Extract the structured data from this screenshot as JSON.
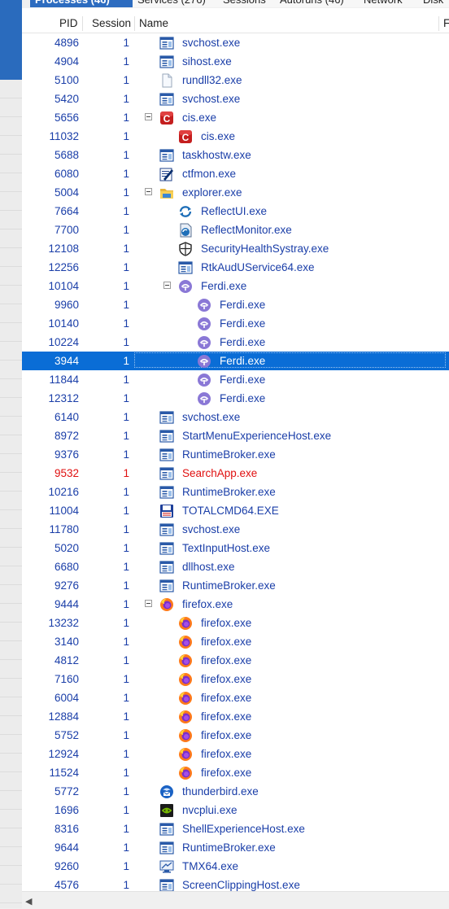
{
  "tabs": [
    {
      "label": "Processes (46)",
      "active": true
    },
    {
      "label": "Services (276)",
      "active": false
    },
    {
      "label": "Sessions",
      "active": false
    },
    {
      "label": "Autoruns (46)",
      "active": false
    },
    {
      "label": "Network",
      "active": false
    },
    {
      "label": "Disk",
      "active": false
    }
  ],
  "columns": {
    "pid": "PID",
    "session": "Session",
    "name": "Name",
    "extra": "F"
  },
  "colors": {
    "pid_text": "#1a3ea8",
    "highlight_red": "#e01010",
    "selection": "#0a6dd6",
    "tab_active": "#2d6cc0"
  },
  "processes": [
    {
      "pid": "4896",
      "session": "1",
      "name": "svchost.exe",
      "indent": 0,
      "icon": "window-app-icon"
    },
    {
      "pid": "4904",
      "session": "1",
      "name": "sihost.exe",
      "indent": 0,
      "icon": "window-app-icon"
    },
    {
      "pid": "5100",
      "session": "1",
      "name": "rundll32.exe",
      "indent": 0,
      "icon": "blank-file-icon"
    },
    {
      "pid": "5420",
      "session": "1",
      "name": "svchost.exe",
      "indent": 0,
      "icon": "window-app-icon"
    },
    {
      "pid": "5656",
      "session": "1",
      "name": "cis.exe",
      "indent": 0,
      "icon": "comodo-icon",
      "expanded": true
    },
    {
      "pid": "11032",
      "session": "1",
      "name": "cis.exe",
      "indent": 1,
      "icon": "comodo-icon"
    },
    {
      "pid": "5688",
      "session": "1",
      "name": "taskhostw.exe",
      "indent": 0,
      "icon": "window-app-icon"
    },
    {
      "pid": "6080",
      "session": "1",
      "name": "ctfmon.exe",
      "indent": 0,
      "icon": "ctfmon-pen-icon"
    },
    {
      "pid": "5004",
      "session": "1",
      "name": "explorer.exe",
      "indent": 0,
      "icon": "folder-icon",
      "expanded": true
    },
    {
      "pid": "7664",
      "session": "1",
      "name": "ReflectUI.exe",
      "indent": 1,
      "icon": "reflect-arrows-icon"
    },
    {
      "pid": "7700",
      "session": "1",
      "name": "ReflectMonitor.exe",
      "indent": 1,
      "icon": "reflect-monitor-icon"
    },
    {
      "pid": "12108",
      "session": "1",
      "name": "SecurityHealthSystray.exe",
      "indent": 1,
      "icon": "shield-icon"
    },
    {
      "pid": "12256",
      "session": "1",
      "name": "RtkAudUService64.exe",
      "indent": 1,
      "icon": "window-app-icon"
    },
    {
      "pid": "10104",
      "session": "1",
      "name": "Ferdi.exe",
      "indent": 1,
      "icon": "ferdi-icon",
      "expanded": true
    },
    {
      "pid": "9960",
      "session": "1",
      "name": "Ferdi.exe",
      "indent": 2,
      "icon": "ferdi-icon"
    },
    {
      "pid": "10140",
      "session": "1",
      "name": "Ferdi.exe",
      "indent": 2,
      "icon": "ferdi-icon"
    },
    {
      "pid": "10224",
      "session": "1",
      "name": "Ferdi.exe",
      "indent": 2,
      "icon": "ferdi-icon"
    },
    {
      "pid": "3944",
      "session": "1",
      "name": "Ferdi.exe",
      "indent": 2,
      "icon": "ferdi-icon",
      "selected": true
    },
    {
      "pid": "11844",
      "session": "1",
      "name": "Ferdi.exe",
      "indent": 2,
      "icon": "ferdi-icon"
    },
    {
      "pid": "12312",
      "session": "1",
      "name": "Ferdi.exe",
      "indent": 2,
      "icon": "ferdi-icon"
    },
    {
      "pid": "6140",
      "session": "1",
      "name": "svchost.exe",
      "indent": 0,
      "icon": "window-app-icon"
    },
    {
      "pid": "8972",
      "session": "1",
      "name": "StartMenuExperienceHost.exe",
      "indent": 0,
      "icon": "window-app-icon"
    },
    {
      "pid": "9376",
      "session": "1",
      "name": "RuntimeBroker.exe",
      "indent": 0,
      "icon": "window-app-icon"
    },
    {
      "pid": "9532",
      "session": "1",
      "name": "SearchApp.exe",
      "indent": 0,
      "icon": "window-app-icon",
      "red": true
    },
    {
      "pid": "10216",
      "session": "1",
      "name": "RuntimeBroker.exe",
      "indent": 0,
      "icon": "window-app-icon"
    },
    {
      "pid": "11004",
      "session": "1",
      "name": "TOTALCMD64.EXE",
      "indent": 0,
      "icon": "floppy-disk-icon"
    },
    {
      "pid": "11780",
      "session": "1",
      "name": "svchost.exe",
      "indent": 0,
      "icon": "window-app-icon"
    },
    {
      "pid": "5020",
      "session": "1",
      "name": "TextInputHost.exe",
      "indent": 0,
      "icon": "window-app-icon"
    },
    {
      "pid": "6680",
      "session": "1",
      "name": "dllhost.exe",
      "indent": 0,
      "icon": "window-app-icon"
    },
    {
      "pid": "9276",
      "session": "1",
      "name": "RuntimeBroker.exe",
      "indent": 0,
      "icon": "window-app-icon"
    },
    {
      "pid": "9444",
      "session": "1",
      "name": "firefox.exe",
      "indent": 0,
      "icon": "firefox-icon",
      "expanded": true
    },
    {
      "pid": "13232",
      "session": "1",
      "name": "firefox.exe",
      "indent": 1,
      "icon": "firefox-icon"
    },
    {
      "pid": "3140",
      "session": "1",
      "name": "firefox.exe",
      "indent": 1,
      "icon": "firefox-icon"
    },
    {
      "pid": "4812",
      "session": "1",
      "name": "firefox.exe",
      "indent": 1,
      "icon": "firefox-icon"
    },
    {
      "pid": "7160",
      "session": "1",
      "name": "firefox.exe",
      "indent": 1,
      "icon": "firefox-icon"
    },
    {
      "pid": "6004",
      "session": "1",
      "name": "firefox.exe",
      "indent": 1,
      "icon": "firefox-icon"
    },
    {
      "pid": "12884",
      "session": "1",
      "name": "firefox.exe",
      "indent": 1,
      "icon": "firefox-icon"
    },
    {
      "pid": "5752",
      "session": "1",
      "name": "firefox.exe",
      "indent": 1,
      "icon": "firefox-icon"
    },
    {
      "pid": "12924",
      "session": "1",
      "name": "firefox.exe",
      "indent": 1,
      "icon": "firefox-icon"
    },
    {
      "pid": "11524",
      "session": "1",
      "name": "firefox.exe",
      "indent": 1,
      "icon": "firefox-icon"
    },
    {
      "pid": "5772",
      "session": "1",
      "name": "thunderbird.exe",
      "indent": 0,
      "icon": "thunderbird-icon"
    },
    {
      "pid": "1696",
      "session": "1",
      "name": "nvcplui.exe",
      "indent": 0,
      "icon": "nvidia-icon"
    },
    {
      "pid": "8316",
      "session": "1",
      "name": "ShellExperienceHost.exe",
      "indent": 0,
      "icon": "window-app-icon"
    },
    {
      "pid": "9644",
      "session": "1",
      "name": "RuntimeBroker.exe",
      "indent": 0,
      "icon": "window-app-icon"
    },
    {
      "pid": "9260",
      "session": "1",
      "name": "TMX64.exe",
      "indent": 0,
      "icon": "tmx-monitor-icon"
    },
    {
      "pid": "4576",
      "session": "1",
      "name": "ScreenClippingHost.exe",
      "indent": 0,
      "icon": "window-app-icon"
    }
  ]
}
